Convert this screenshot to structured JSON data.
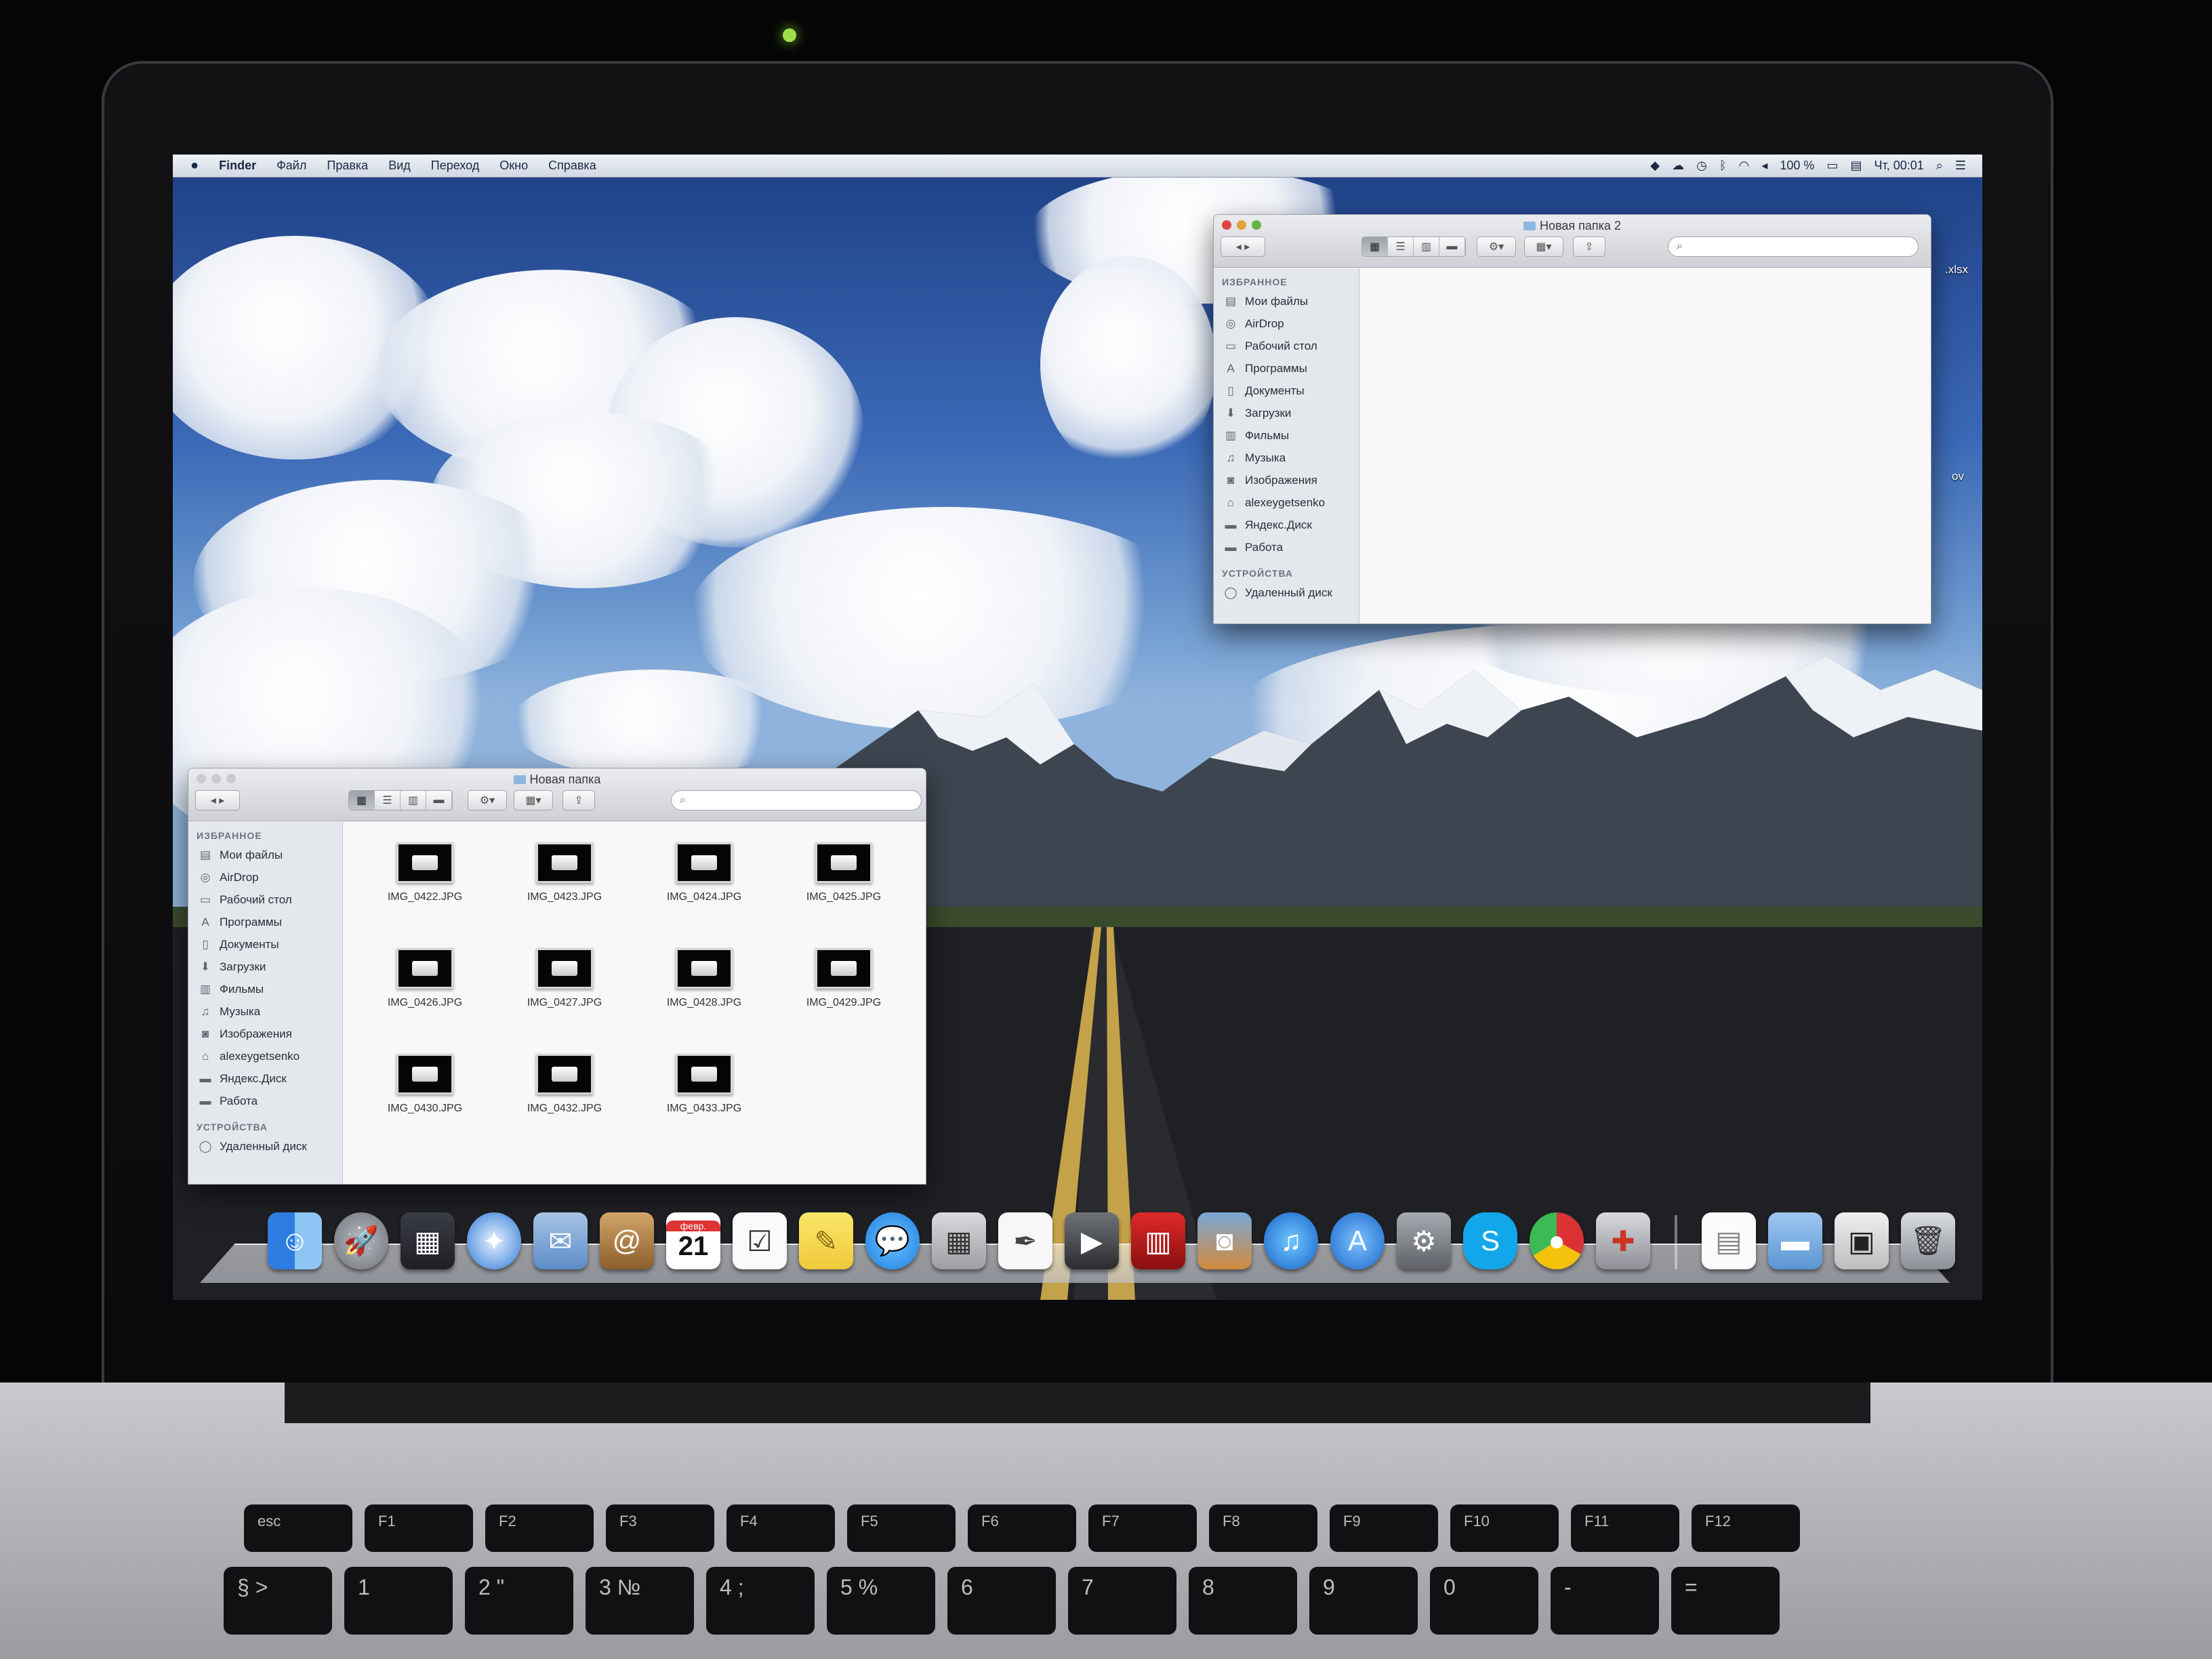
{
  "menubar": {
    "apple": "",
    "items": [
      "Finder",
      "Файл",
      "Правка",
      "Вид",
      "Переход",
      "Окно",
      "Справка"
    ],
    "battery": "100 %",
    "clock": "Чт, 00:01"
  },
  "window_back": {
    "title": "Новая папка 2",
    "sidebar": {
      "favorites_header": "ИЗБРАННОЕ",
      "favorites": [
        "Мои файлы",
        "AirDrop",
        "Рабочий стол",
        "Программы",
        "Документы",
        "Загрузки",
        "Фильмы",
        "Музыка",
        "Изображения",
        "alexeygetsenko",
        "Яндекс.Диск",
        "Работа"
      ],
      "devices_header": "УСТРОЙСТВА",
      "devices": [
        "Удаленный диск"
      ]
    }
  },
  "window_front": {
    "title": "Новая папка",
    "sidebar": {
      "favorites_header": "ИЗБРАННОЕ",
      "favorites": [
        "Мои файлы",
        "AirDrop",
        "Рабочий стол",
        "Программы",
        "Документы",
        "Загрузки",
        "Фильмы",
        "Музыка",
        "Изображения",
        "alexeygetsenko",
        "Яндекс.Диск",
        "Работа"
      ],
      "devices_header": "УСТРОЙСТВА",
      "devices": [
        "Удаленный диск"
      ]
    },
    "files": [
      "IMG_0422.JPG",
      "IMG_0423.JPG",
      "IMG_0424.JPG",
      "IMG_0425.JPG",
      "IMG_0426.JPG",
      "IMG_0427.JPG",
      "IMG_0428.JPG",
      "IMG_0429.JPG",
      "IMG_0430.JPG",
      "IMG_0432.JPG",
      "IMG_0433.JPG"
    ]
  },
  "desktop_edge_labels": [
    ".xlsx",
    "ov"
  ],
  "dock": {
    "calendar_month": "февр.",
    "calendar_day": "21",
    "icons": [
      "finder-icon",
      "launchpad-icon",
      "mission-control-icon",
      "safari-icon",
      "mail-icon",
      "contacts-icon",
      "calendar-icon",
      "reminders-icon",
      "notes-icon",
      "messages-icon",
      "calculator-icon",
      "textedit-icon",
      "facetime-icon",
      "photo-booth-icon",
      "iphoto-icon",
      "itunes-icon",
      "app-store-icon",
      "system-preferences-icon",
      "skype-icon",
      "chrome-icon",
      "utility-icon",
      "document-icon",
      "folder-icon",
      "window-stack-icon",
      "trash-icon"
    ]
  },
  "keyboard": {
    "row1": [
      "esc",
      "F1",
      "F2",
      "F3",
      "F4",
      "F5",
      "F6",
      "F7",
      "F8",
      "F9",
      "F10",
      "F11",
      "F12"
    ],
    "row2": [
      "±",
      "!",
      "@",
      "#",
      "$",
      "%",
      "^",
      "&",
      "*",
      "(",
      ")",
      "_",
      "+"
    ],
    "row2_low": [
      "§ >",
      "1",
      "2 \"",
      "3 №",
      "4 ;",
      "5 %",
      "6",
      "7",
      "8",
      "9",
      "0",
      "-",
      "="
    ]
  }
}
